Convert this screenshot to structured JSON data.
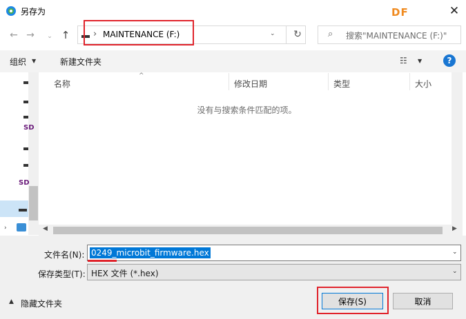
{
  "window": {
    "title": "另存为",
    "brand_logo_text": "DF",
    "close_glyph": "✕"
  },
  "nav": {
    "back_glyph": "←",
    "forward_glyph": "→",
    "recent_glyph": "⌄",
    "up_glyph": "↑",
    "address_chevron": "›",
    "address_text": "MAINTENANCE (F:)",
    "address_dropdown_glyph": "⌄",
    "refresh_glyph": "↻",
    "search_glyph": "⌕",
    "search_placeholder": "搜索\"MAINTENANCE (F:)\""
  },
  "toolbar": {
    "organize_label": "组织",
    "organize_caret": "▼",
    "new_folder_label": "新建文件夹",
    "view_glyph": "☷",
    "view_caret": "▼",
    "help_glyph": "?"
  },
  "navpane": {
    "sd_label": "SD",
    "expand_glyph": "›"
  },
  "filelist": {
    "sort_glyph": "^",
    "columns": [
      "名称",
      "修改日期",
      "类型",
      "大小"
    ],
    "empty_message": "没有与搜索条件匹配的项。",
    "hscroll_left_glyph": "◀",
    "hscroll_right_glyph": "▶"
  },
  "form": {
    "filename_label": "文件名(N):",
    "filename_value": "0249_microbit_firmware.hex",
    "filename_dropdown_glyph": "⌄",
    "filetype_label": "保存类型(T):",
    "filetype_value": "HEX 文件 (*.hex)",
    "filetype_dropdown_glyph": "⌄",
    "hide_folders_caret": "▲",
    "hide_folders_label": "隐藏文件夹",
    "save_label": "保存(S)",
    "cancel_label": "取消"
  },
  "colors": {
    "annotation_red": "#e0222a",
    "accent_blue": "#0078d7",
    "brand_orange": "#f08a1f"
  },
  "icons": [
    "app-browser-icon",
    "drive-icon",
    "sd-card-icon",
    "network-icon",
    "search-icon",
    "refresh-icon",
    "help-icon",
    "view-icon"
  ]
}
